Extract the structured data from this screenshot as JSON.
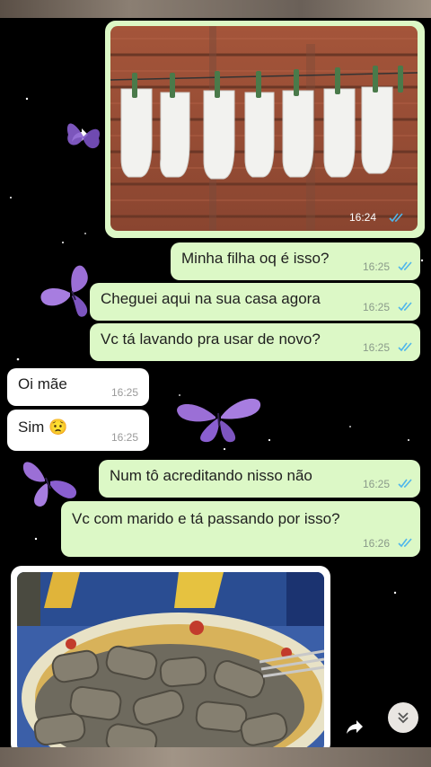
{
  "chat": {
    "image1": {
      "time": "16:24"
    },
    "messages": [
      {
        "text": "Minha filha oq é isso?",
        "time": "16:25"
      },
      {
        "text": "Cheguei aqui na sua casa agora",
        "time": "16:25"
      },
      {
        "text": "Vc tá lavando pra usar de novo?",
        "time": "16:25"
      },
      {
        "text": "Oi mãe",
        "time": "16:25"
      },
      {
        "text": "Sim 😟",
        "time": "16:25"
      },
      {
        "text": "Num tô acreditando nisso não",
        "time": "16:25"
      },
      {
        "text": "Vc com marido e tá passando por isso?",
        "time": "16:26"
      }
    ]
  },
  "colors": {
    "outgoing": "#dcf8c6",
    "incoming": "#ffffff",
    "read_ticks": "#4fb6ec",
    "butterfly": "#9b6fd6"
  },
  "icons": [
    "forward-icon",
    "double-chevron-down-icon",
    "double-check-icon",
    "butterfly-sticker"
  ]
}
